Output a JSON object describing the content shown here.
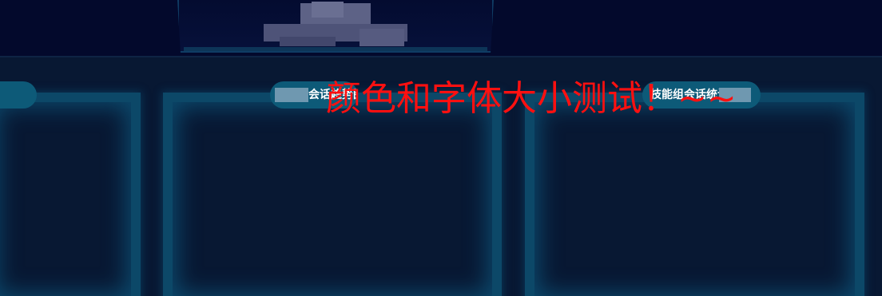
{
  "header": {
    "logo_name": "obscured-logo"
  },
  "panels": {
    "left_tab": "",
    "mid_tab": "会话趋势图",
    "right_tab": "技能组会话统计"
  },
  "overlay": {
    "text": "颜色和字体大小测试！~~"
  },
  "colors": {
    "background": "#081833",
    "header": "#03092c",
    "panel_border": "#0c4868",
    "tab": "#0d5a78",
    "overlay_text": "#ff1010"
  }
}
